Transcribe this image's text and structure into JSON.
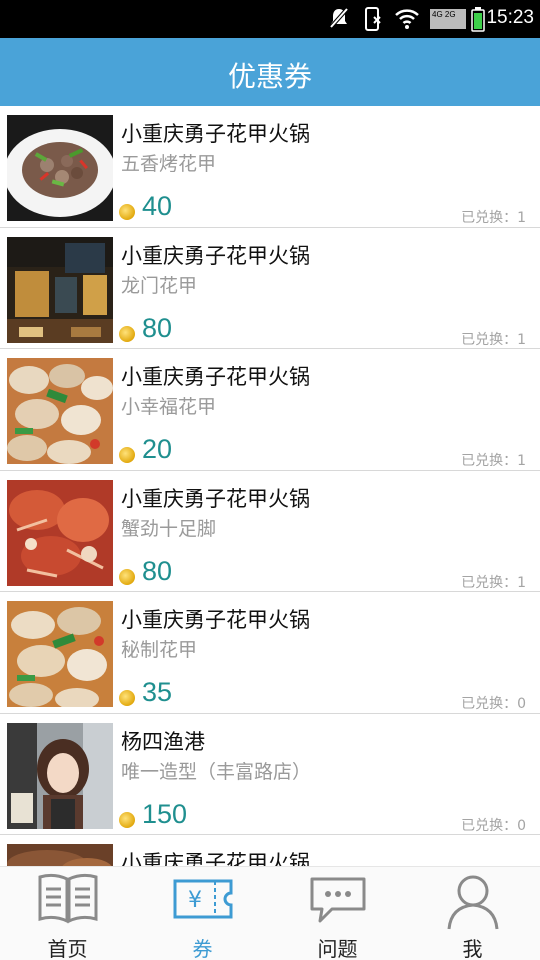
{
  "status_bar": {
    "time": "15:23",
    "network": "4G 2G"
  },
  "header": {
    "title": "优惠券"
  },
  "coupons": [
    {
      "shop": "小重庆勇子花甲火锅",
      "item": "五香烤花甲",
      "price": "40",
      "redeemed": "已兑换：1",
      "image": "stir-fry-clams"
    },
    {
      "shop": "小重庆勇子花甲火锅",
      "item": "龙门花甲",
      "price": "80",
      "redeemed": "已兑换：1",
      "image": "restaurant-storefront"
    },
    {
      "shop": "小重庆勇子花甲火锅",
      "item": "小幸福花甲",
      "price": "20",
      "redeemed": "已兑换：1",
      "image": "clams-dish"
    },
    {
      "shop": "小重庆勇子花甲火锅",
      "item": "蟹劲十足脚",
      "price": "80",
      "redeemed": "已兑换：1",
      "image": "crab-dish"
    },
    {
      "shop": "小重庆勇子花甲火锅",
      "item": "秘制花甲",
      "price": "35",
      "redeemed": "已兑换：0",
      "image": "clams-dish"
    },
    {
      "shop": "杨四渔港",
      "item": "唯一造型（丰富路店）",
      "price": "150",
      "redeemed": "已兑换：0",
      "image": "salon-portrait"
    },
    {
      "shop": "小重庆勇子花甲火锅",
      "item": "",
      "price": "",
      "redeemed": "",
      "image": "food-partial"
    }
  ],
  "tabs": [
    {
      "label": "首页",
      "icon": "book-icon",
      "active": false
    },
    {
      "label": "券",
      "icon": "ticket-icon",
      "active": true
    },
    {
      "label": "问题",
      "icon": "chat-bubble-icon",
      "active": false
    },
    {
      "label": "我",
      "icon": "person-icon",
      "active": false
    }
  ],
  "colors": {
    "header": "#4aa3d8",
    "price": "#1f8f8f",
    "active_tab": "#3d9bd3"
  }
}
